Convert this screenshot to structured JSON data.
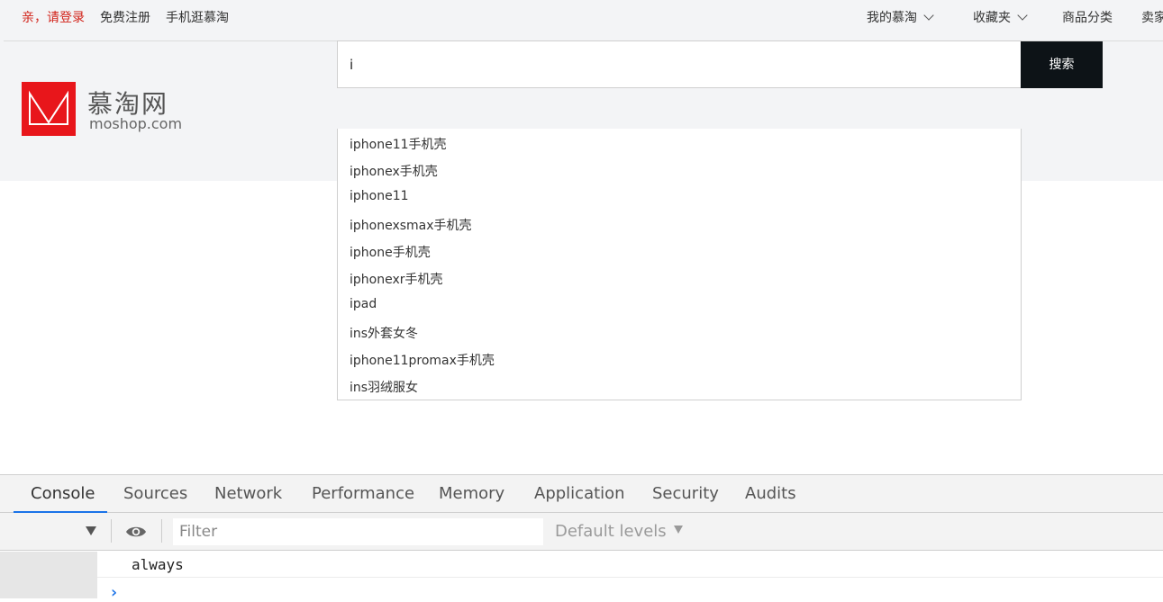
{
  "topbar": {
    "login": "亲，请登录",
    "register": "免费注册",
    "mobile": "手机逛慕淘",
    "my_moshop": "我的慕淘",
    "favorites": "收藏夹",
    "categories": "商品分类",
    "seller": "卖家"
  },
  "logo": {
    "name": "慕淘网",
    "domain": "moshop.com"
  },
  "search": {
    "value": "i",
    "button": "搜索",
    "suggestions": [
      "iphone11手机壳",
      "iphonex手机壳",
      "iphone11",
      "iphonexsmax手机壳",
      "iphone手机壳",
      "iphonexr手机壳",
      "ipad",
      "ins外套女冬",
      "iphone11promax手机壳",
      "ins羽绒服女"
    ]
  },
  "devtools": {
    "tabs": [
      "Console",
      "Sources",
      "Network",
      "Performance",
      "Memory",
      "Application",
      "Security",
      "Audits"
    ],
    "active_tab": "Console",
    "filter_placeholder": "Filter",
    "levels": "Default levels",
    "log": "always",
    "prompt": "›"
  },
  "colors": {
    "brand_red": "#e8161b",
    "search_button": "#0d1317",
    "accent_blue": "#1a73e8"
  }
}
